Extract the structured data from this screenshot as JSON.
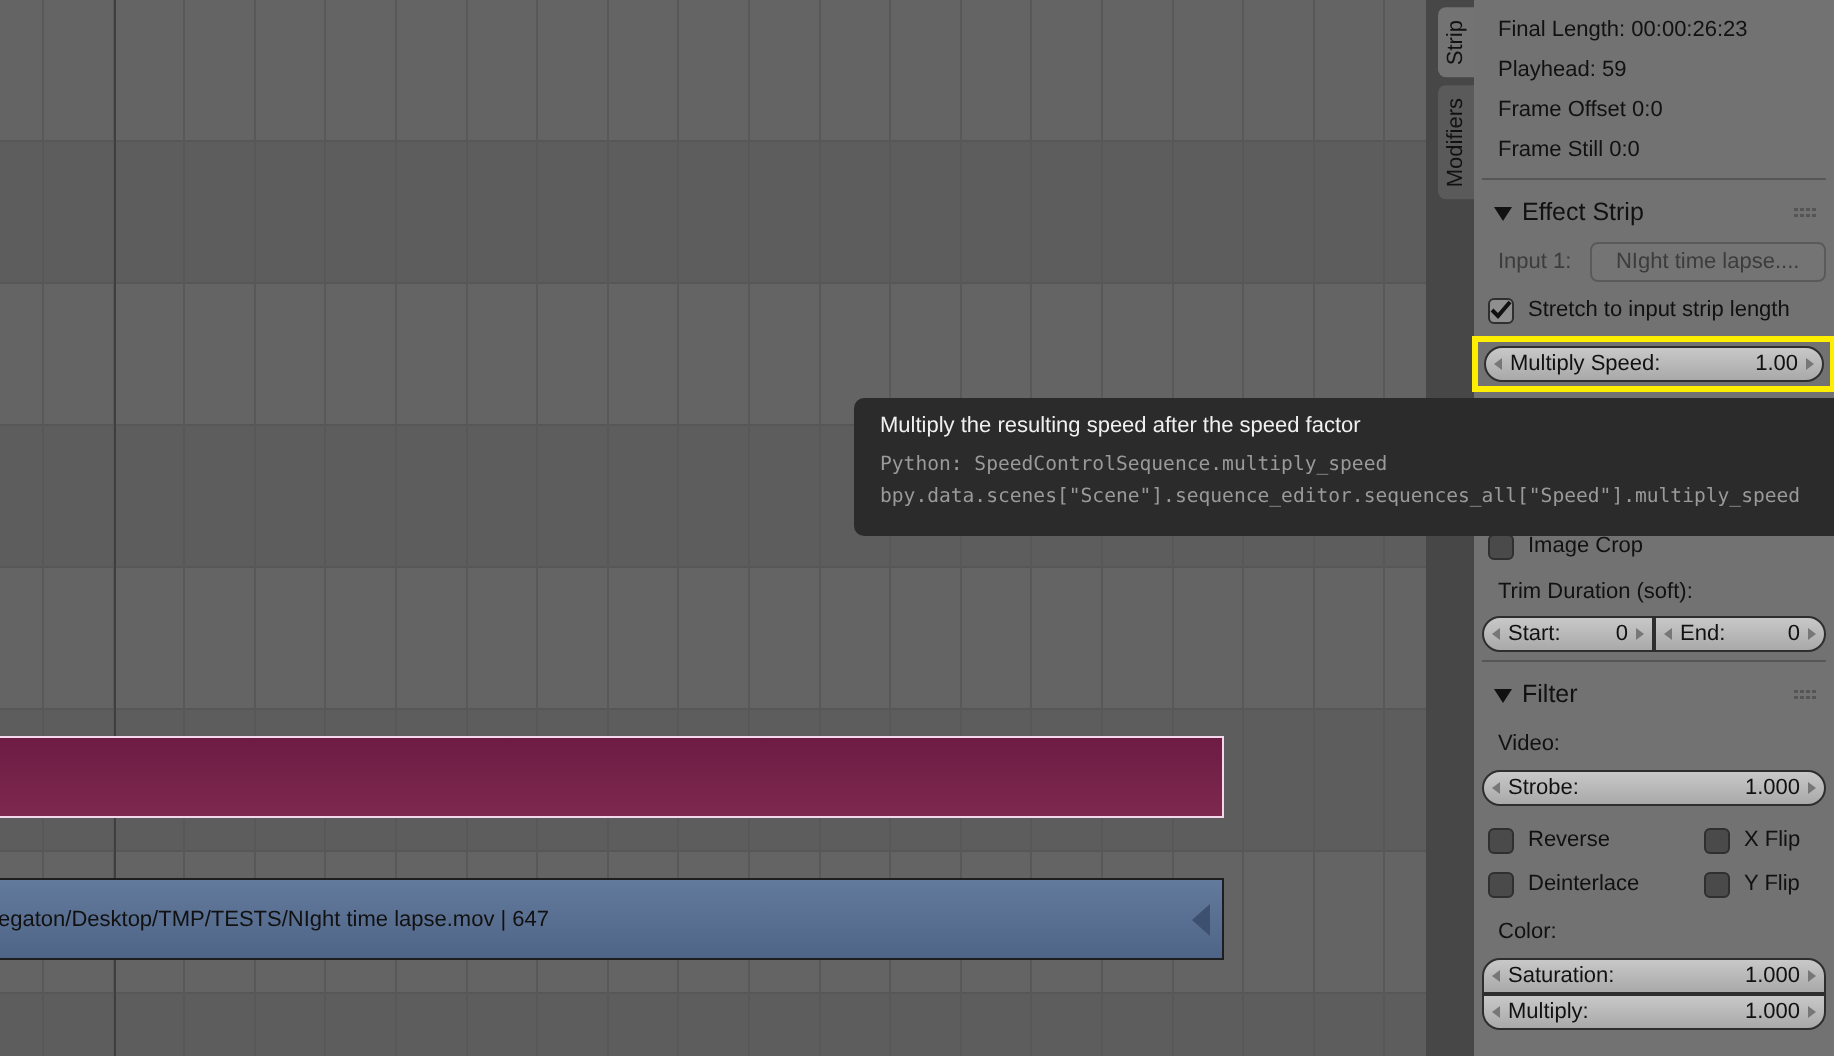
{
  "strips": [
    {
      "kind": "effect",
      "selected": true
    },
    {
      "kind": "movie",
      "label": "egaton/Desktop/TMP/TESTS/NIght time lapse.mov | 647",
      "selected": false
    }
  ],
  "tabs": [
    {
      "label": "Strip",
      "selected": true
    },
    {
      "label": "Modifiers",
      "selected": false
    }
  ],
  "info": [
    "Final Length: 00:00:26:23",
    "Playhead: 59",
    "Frame Offset 0:0",
    "Frame Still 0:0"
  ],
  "effect_strip": {
    "title": "Effect Strip",
    "expanded": true,
    "input_label": "Input 1:",
    "input_value": "NIght time lapse....",
    "input_disabled": true,
    "stretch": {
      "label": "Stretch to input strip length",
      "checked": true
    },
    "multiply_speed": {
      "label": "Multiply Speed:",
      "value": "1.00",
      "highlighted": true
    }
  },
  "strip_input": {
    "image_crop": {
      "label": "Image Crop",
      "checked": false
    },
    "trim_label": "Trim Duration (soft):",
    "start": {
      "label": "Start:",
      "value": "0"
    },
    "end": {
      "label": "End:",
      "value": "0"
    }
  },
  "filter": {
    "title": "Filter",
    "expanded": true,
    "video_label": "Video:",
    "strobe": {
      "label": "Strobe:",
      "value": "1.000"
    },
    "checkboxes": [
      {
        "label": "Reverse",
        "checked": false
      },
      {
        "label": "X Flip",
        "checked": false
      },
      {
        "label": "Deinterlace",
        "checked": false
      },
      {
        "label": "Y Flip",
        "checked": false
      }
    ],
    "color_label": "Color:",
    "color_fields": [
      {
        "label": "Saturation:",
        "value": "1.000"
      },
      {
        "label": "Multiply:",
        "value": "1.000"
      }
    ]
  },
  "tooltip": {
    "title": "Multiply the resulting speed after the speed factor",
    "python": "Python: SpeedControlSequence.multiply_speed",
    "path": "bpy.data.scenes[\"Scene\"].sequence_editor.sequences_all[\"Speed\"].multiply_speed"
  }
}
